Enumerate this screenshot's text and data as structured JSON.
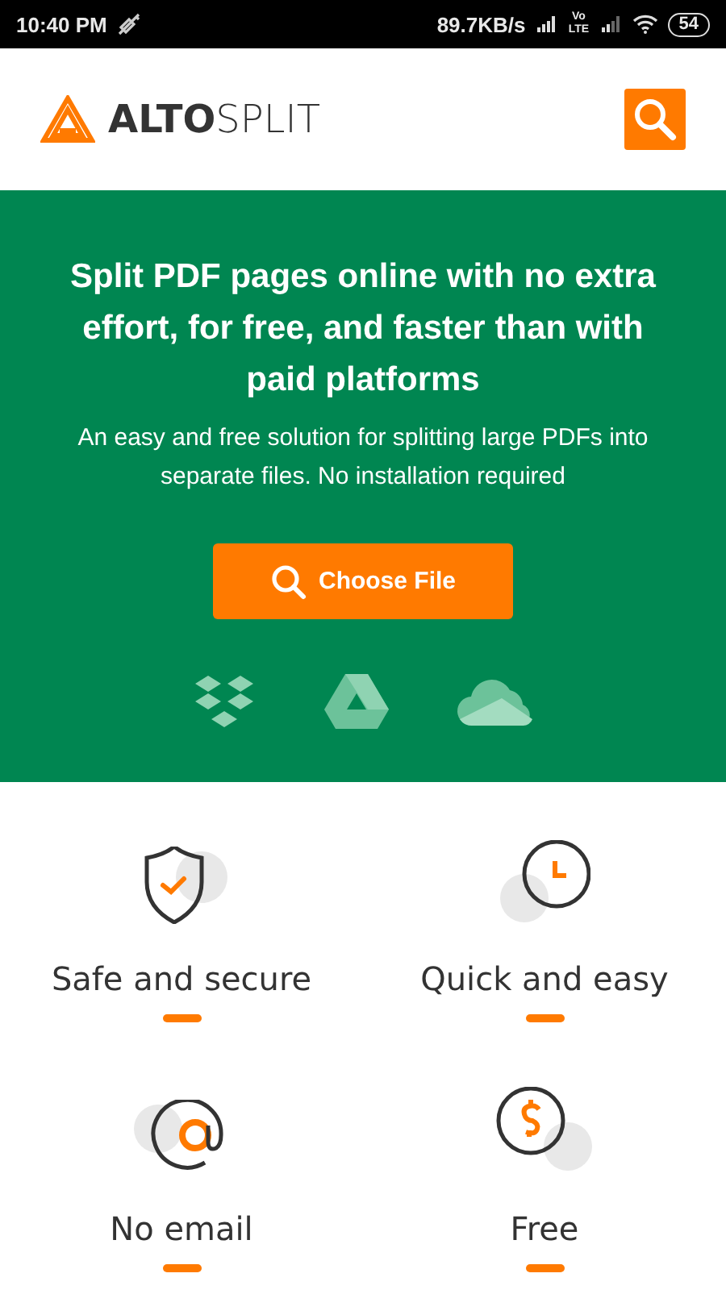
{
  "status_bar": {
    "time": "10:40 PM",
    "speed": "89.7KB/s",
    "volte": "Vo LTE",
    "battery": "54"
  },
  "header": {
    "logo": "**ALTO**SPLIT"
  },
  "hero": {
    "title": "Split PDF pages online with no extra effort, for free, and faster than with paid platforms",
    "subtitle": "An easy and free solution for splitting large PDFs into separate files. No installation required",
    "button": "Choose File"
  },
  "features": [
    {
      "kind": "shield",
      "label": "Safe and secure"
    },
    {
      "kind": "clock",
      "label": "Quick and easy"
    },
    {
      "kind": "at",
      "label": "No email"
    },
    {
      "kind": "dollar",
      "label": "Free"
    }
  ]
}
